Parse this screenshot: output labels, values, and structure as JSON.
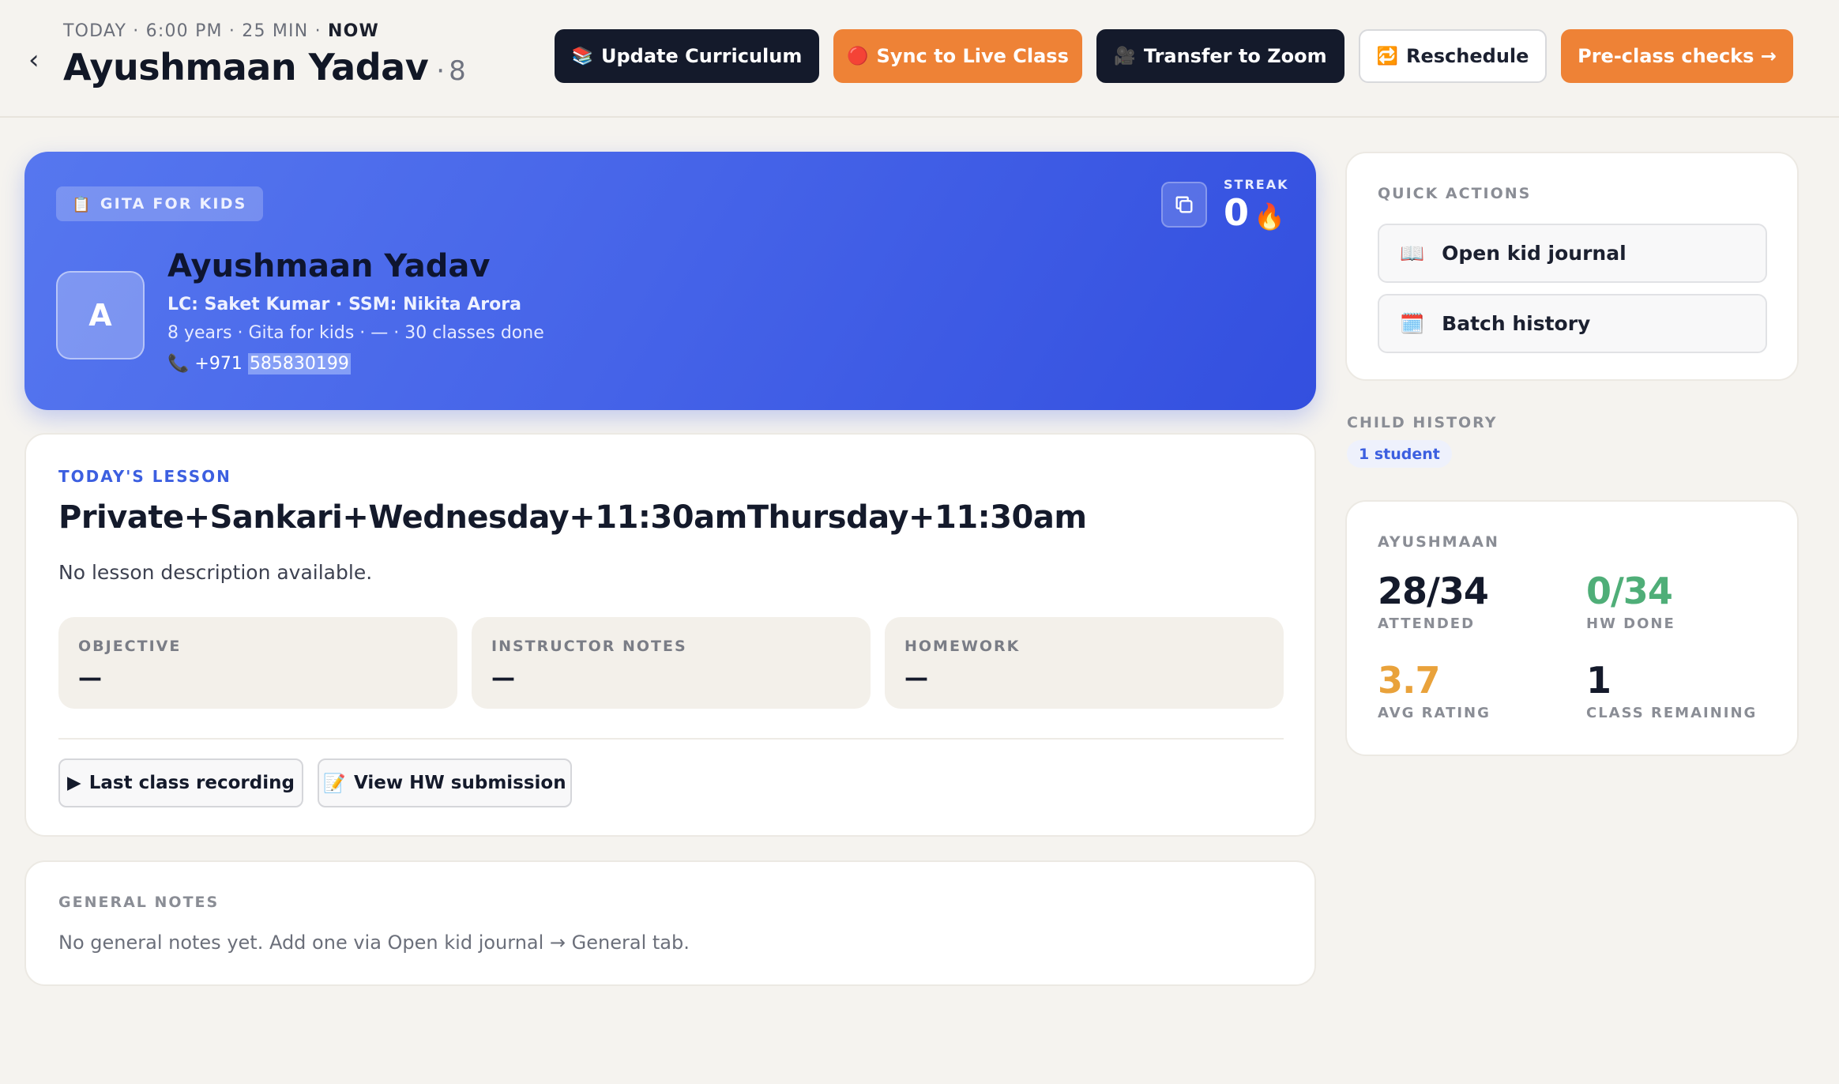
{
  "header": {
    "meta_prefix": "TODAY · 6:00 PM · 25 MIN ·",
    "meta_now": "NOW",
    "student_name": "Ayushmaan Yadav",
    "separator": "·",
    "count": "8",
    "buttons": {
      "update_curriculum": "Update Curriculum",
      "sync_live": "Sync to Live Class",
      "transfer_zoom": "Transfer to Zoom",
      "reschedule": "Reschedule",
      "pre_class": "Pre-class checks →"
    },
    "icons": {
      "update_curriculum": "📚",
      "sync_live": "🔴",
      "transfer_zoom": "🎥",
      "reschedule": "🔁"
    }
  },
  "hero": {
    "program_icon": "📋",
    "program": "GITA FOR KIDS",
    "streak_label": "STREAK",
    "streak_value": "0",
    "streak_icon": "🔥",
    "avatar_letter": "A",
    "name": "Ayushmaan Yadav",
    "staff_line": "LC: Saket Kumar · SSM: Nikita Arora",
    "details_line": "8 years · Gita for kids · — · 30 classes done",
    "phone_icon": "📞",
    "phone_code": "+971",
    "phone_number": "585830199",
    "gradient": [
      "#5677ef",
      "#334fdf"
    ]
  },
  "lesson": {
    "eyebrow": "TODAY'S LESSON",
    "title": "Private+Sankari+Wednesday+11:30amThursday+11:30am",
    "description": "No lesson description available.",
    "fields": [
      {
        "label": "OBJECTIVE",
        "value": "—"
      },
      {
        "label": "INSTRUCTOR NOTES",
        "value": "—"
      },
      {
        "label": "HOMEWORK",
        "value": "—"
      }
    ],
    "buttons": {
      "recording_icon": "▶",
      "recording": "Last class recording",
      "hw_icon": "📝",
      "hw": "View HW submission"
    }
  },
  "notes": {
    "eyebrow": "GENERAL NOTES",
    "text": "No general notes yet. Add one via Open kid journal → General tab."
  },
  "quick_actions": {
    "eyebrow": "QUICK ACTIONS",
    "items": [
      {
        "icon": "📖",
        "label": "Open kid journal"
      },
      {
        "icon": "🗓️",
        "label": "Batch history"
      }
    ]
  },
  "child_history": {
    "eyebrow": "CHILD HISTORY",
    "pill": "1 student"
  },
  "stats": {
    "eyebrow": "AYUSHMAAN",
    "items": [
      {
        "value": "28/34",
        "label": "ATTENDED",
        "color": "#141a2b"
      },
      {
        "value": "0/34",
        "label": "HW DONE",
        "color": "#4fae78"
      },
      {
        "value": "3.7",
        "label": "AVG RATING",
        "color": "#e9a23b"
      },
      {
        "value": "1",
        "label": "CLASS REMAINING",
        "color": "#141a2b"
      }
    ]
  },
  "colors": {
    "accent": "#3c5fe0",
    "orange": "#ee8236",
    "dark": "#141a2b",
    "background": "#f5f3ef"
  }
}
